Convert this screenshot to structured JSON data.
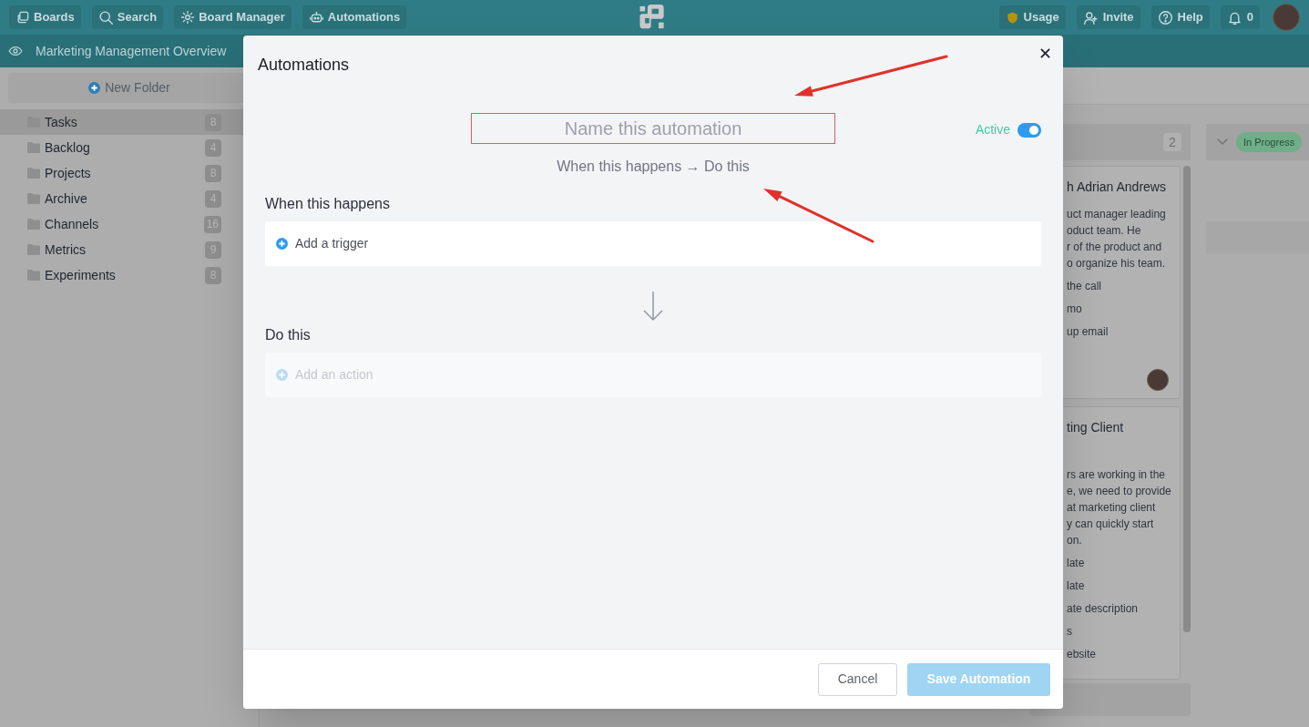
{
  "topbar": {
    "left_buttons": [
      {
        "kind": "boards",
        "label": "Boards"
      },
      {
        "kind": "search",
        "label": "Search"
      },
      {
        "kind": "gear",
        "label": "Board Manager"
      },
      {
        "kind": "robot",
        "label": "Automations"
      }
    ],
    "right_buttons": [
      {
        "kind": "shield",
        "label": "Usage"
      },
      {
        "kind": "invite",
        "label": "Invite"
      },
      {
        "kind": "help",
        "label": "Help"
      },
      {
        "kind": "bell",
        "label": "0"
      }
    ]
  },
  "board_bar": {
    "title": "Marketing Management Overview"
  },
  "sidebar": {
    "new_folder": "New Folder",
    "folders": [
      {
        "label": "Tasks",
        "count": "8",
        "selected": true
      },
      {
        "label": "Backlog",
        "count": "4",
        "selected": false
      },
      {
        "label": "Projects",
        "count": "8",
        "selected": false
      },
      {
        "label": "Archive",
        "count": "4",
        "selected": false
      },
      {
        "label": "Channels",
        "count": "16",
        "selected": false
      },
      {
        "label": "Metrics",
        "count": "9",
        "selected": false
      },
      {
        "label": "Experiments",
        "count": "8",
        "selected": false
      }
    ]
  },
  "board": {
    "column_1": {
      "count": "2",
      "cards": [
        {
          "title": "h Adrian Andrews",
          "description": [
            "uct manager leading",
            "oduct team. He",
            "r of the product and",
            "o organize his team."
          ],
          "items": [
            "the call",
            "mo",
            "up email"
          ],
          "avatar": true
        },
        {
          "title": "ting Client",
          "description": [
            "rs are working in the",
            "e, we need to provide",
            "at marketing client",
            "y can quickly start",
            "on."
          ],
          "items": [
            "late",
            "late",
            "ate description",
            "s",
            "ebsite"
          ],
          "avatar": false
        }
      ]
    },
    "column_2": {
      "status": "In Progress"
    }
  },
  "modal": {
    "title": "Automations",
    "name_field": {
      "placeholder": "Name this automation"
    },
    "active": {
      "label": "Active",
      "on": true
    },
    "flow_hint": "When this happens → Do this",
    "sections": [
      {
        "heading": "When this happens",
        "add_label": "Add a trigger",
        "disabled": false
      },
      {
        "heading": "Do this",
        "add_label": "Add an action",
        "disabled": true
      }
    ],
    "buttons": [
      {
        "kind": "cancel",
        "label": "Cancel",
        "disabled": false
      },
      {
        "kind": "primary",
        "label": "Save Automation",
        "disabled": true
      }
    ]
  }
}
